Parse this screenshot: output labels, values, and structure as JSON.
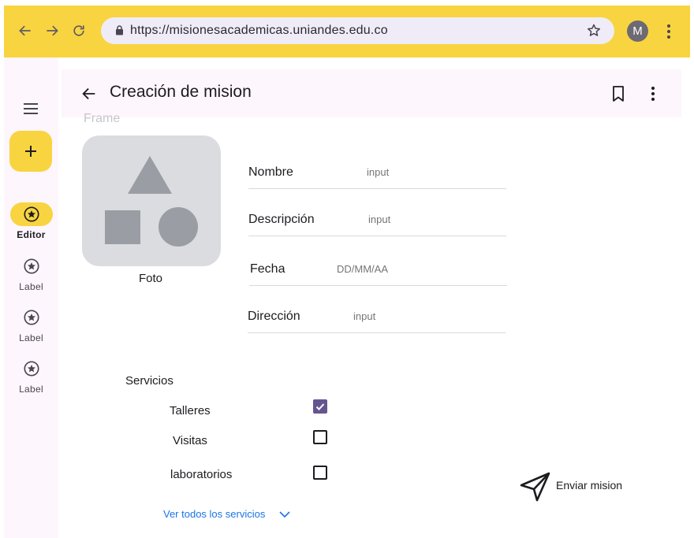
{
  "browser": {
    "url": "https://misionesacademicas.uniandes.edu.co",
    "avatar_letter": "M",
    "accent_color": "#f8d440"
  },
  "rail": {
    "fab_icon": "plus-icon",
    "items": [
      {
        "label": "Editor",
        "icon": "star-circle-icon",
        "active": true
      },
      {
        "label": "Label",
        "icon": "star-circle-icon",
        "active": false
      },
      {
        "label": "Label",
        "icon": "star-circle-icon",
        "active": false
      },
      {
        "label": "Label",
        "icon": "star-circle-icon",
        "active": false
      }
    ]
  },
  "header": {
    "title": "Creación de mision"
  },
  "form": {
    "frame_label": "Frame",
    "photo_caption": "Foto",
    "fields": [
      {
        "label": "Nombre",
        "placeholder": "input"
      },
      {
        "label": "Descripción",
        "placeholder": "input"
      },
      {
        "label": "Fecha",
        "placeholder": "DD/MM/AA"
      },
      {
        "label": "Dirección",
        "placeholder": "input"
      }
    ]
  },
  "servicios": {
    "title": "Servicios",
    "items": [
      {
        "label": "Talleres",
        "checked": true
      },
      {
        "label": "Visitas",
        "checked": false
      },
      {
        "label": "laboratorios",
        "checked": false
      }
    ],
    "ver_todos": "Ver todos los servicios"
  },
  "send": {
    "label": "Enviar mision"
  }
}
